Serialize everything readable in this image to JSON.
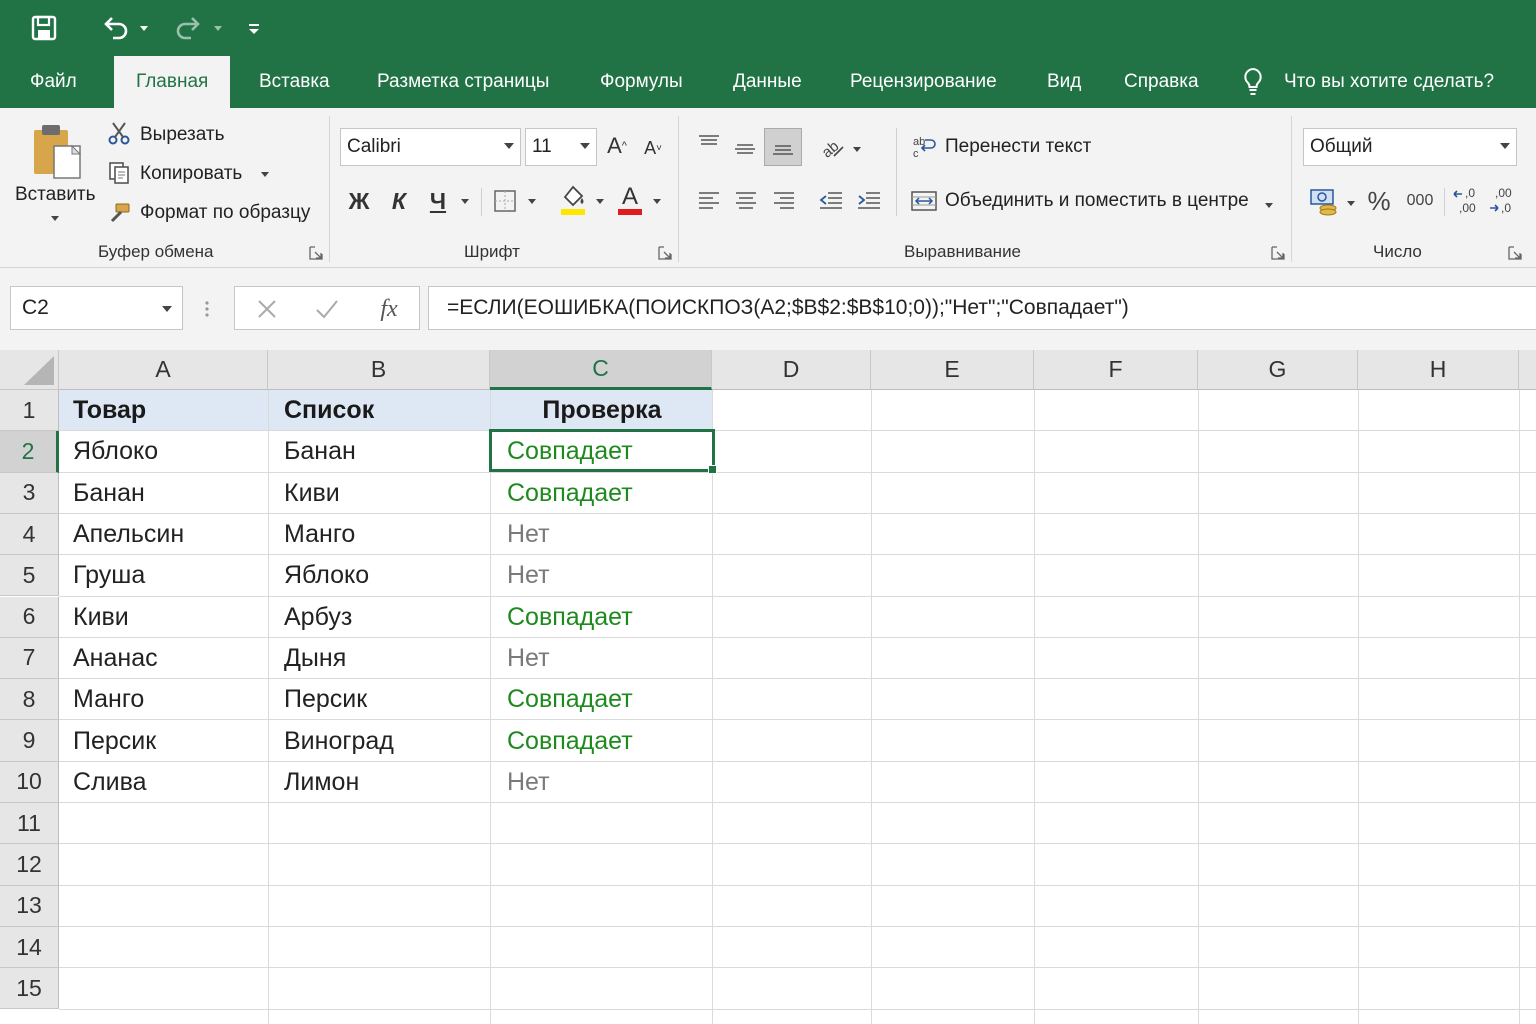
{
  "tabs": [
    {
      "label": "Файл",
      "active": false
    },
    {
      "label": "Главная",
      "active": true
    },
    {
      "label": "Вставка",
      "active": false
    },
    {
      "label": "Разметка страницы",
      "active": false
    },
    {
      "label": "Формулы",
      "active": false
    },
    {
      "label": "Данные",
      "active": false
    },
    {
      "label": "Рецензирование",
      "active": false
    },
    {
      "label": "Вид",
      "active": false
    },
    {
      "label": "Справка",
      "active": false
    }
  ],
  "tell_me": "Что вы хотите сделать?",
  "ribbon": {
    "clipboard": {
      "paste": "Вставить",
      "cut": "Вырезать",
      "copy": "Копировать",
      "format_painter": "Формат по образцу",
      "group": "Буфер обмена"
    },
    "font": {
      "name": "Calibri",
      "size": "11",
      "bold": "Ж",
      "italic": "К",
      "underline": "Ч",
      "group": "Шрифт",
      "fill_color": "#ffe600",
      "font_color": "#e01b1b"
    },
    "alignment": {
      "wrap_text": "Перенести текст",
      "merge_center": "Объединить и поместить в центре",
      "group": "Выравнивание"
    },
    "number": {
      "format": "Общий",
      "percent": "%",
      "thousands": "000",
      "group": "Число"
    }
  },
  "formula_bar": {
    "name_box": "C2",
    "fx": "fx",
    "formula": "=ЕСЛИ(ЕОШИБКА(ПОИСКПОЗ(A2;$B$2:$B$10;0));\"Нет\";\"Совпадает\")"
  },
  "grid": {
    "columns": [
      "A",
      "B",
      "C",
      "D",
      "E",
      "F",
      "G",
      "H"
    ],
    "selected_column": "C",
    "selected_row": "2",
    "rows": [
      {
        "n": "1",
        "a": "Товар",
        "b": "Список",
        "c": "Проверка"
      },
      {
        "n": "2",
        "a": "Яблоко",
        "b": "Банан",
        "c": "Совпадает"
      },
      {
        "n": "3",
        "a": "Банан",
        "b": "Киви",
        "c": "Совпадает"
      },
      {
        "n": "4",
        "a": "Апельсин",
        "b": "Манго",
        "c": "Нет"
      },
      {
        "n": "5",
        "a": "Груша",
        "b": "Яблоко",
        "c": "Нет"
      },
      {
        "n": "6",
        "a": "Киви",
        "b": "Арбуз",
        "c": "Совпадает"
      },
      {
        "n": "7",
        "a": "Ананас",
        "b": "Дыня",
        "c": "Нет"
      },
      {
        "n": "8",
        "a": "Манго",
        "b": "Персик",
        "c": "Совпадает"
      },
      {
        "n": "9",
        "a": "Персик",
        "b": "Виноград",
        "c": "Совпадает"
      },
      {
        "n": "10",
        "a": "Слива",
        "b": "Лимон",
        "c": "Нет"
      },
      {
        "n": "11",
        "a": "",
        "b": "",
        "c": ""
      },
      {
        "n": "12",
        "a": "",
        "b": "",
        "c": ""
      },
      {
        "n": "13",
        "a": "",
        "b": "",
        "c": ""
      },
      {
        "n": "14",
        "a": "",
        "b": "",
        "c": ""
      },
      {
        "n": "15",
        "a": "",
        "b": "",
        "c": ""
      }
    ]
  },
  "colors": {
    "brand": "#217346",
    "match": "#1e8a1e",
    "no_match": "#7a7a7a",
    "header_fill": "#dde8f4"
  }
}
